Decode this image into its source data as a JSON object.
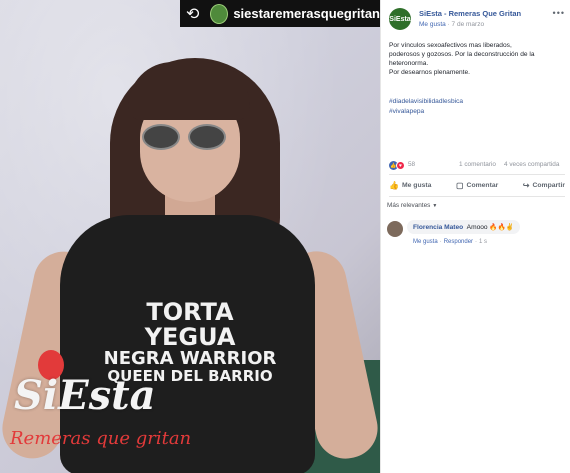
{
  "photo": {
    "repost_user": "siestaremerasquegritan",
    "shirt_lines": [
      "TORTA YEGUA",
      "NEGRA WARRIOR",
      "QUEEN DEL BARRIO"
    ],
    "brand_title": "SiEsta",
    "brand_tagline": "Remeras que gritan"
  },
  "post": {
    "page_avatar_text": "SiEsta",
    "page_name": "SiEsta - Remeras Que Gritan",
    "meta_like": "Me gusta",
    "meta_date": "7 de marzo",
    "paragraphs": [
      "Por vínculos sexoafectivos mas liberados,",
      "poderosos y gozosos. Por la deconstrucción de la heteronorma.",
      "Por desearnos plenamente."
    ],
    "hashtags": [
      "#diadelavisibilidadlesbica",
      "#vivalapepa"
    ],
    "reaction_count": "58",
    "comment_count": "1 comentario",
    "share_count": "4 veces compartida",
    "actions": {
      "like": "Me gusta",
      "comment": "Comentar",
      "share": "Compartir"
    },
    "relevance": "Más relevantes"
  },
  "comment": {
    "author": "Florencia Mateo",
    "text": "Amooo",
    "like": "Me gusta",
    "reply": "Responder",
    "time": "1 s"
  },
  "colors": {
    "link": "#365899",
    "brand_red": "#e23a3a",
    "like_blue": "#4267b2",
    "love_red": "#f0284a"
  }
}
